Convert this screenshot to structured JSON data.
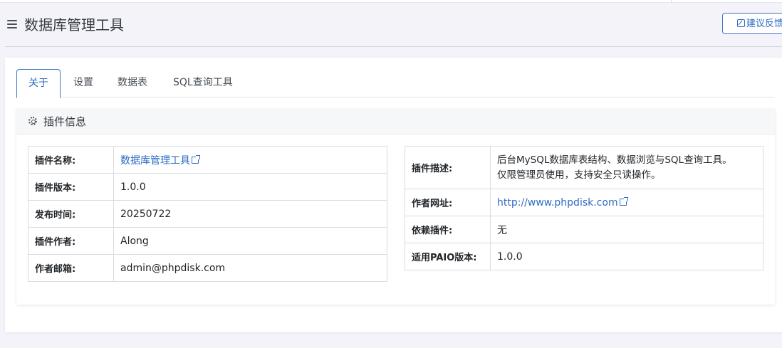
{
  "header": {
    "title": "数据库管理工具",
    "feedback_label": "建议反馈"
  },
  "tabs": [
    {
      "label": "关于",
      "active": true
    },
    {
      "label": "设置",
      "active": false
    },
    {
      "label": "数据表",
      "active": false
    },
    {
      "label": "SQL查询工具",
      "active": false
    }
  ],
  "plugin_info": {
    "title": "插件信息",
    "left": [
      {
        "key": "插件名称:",
        "value": "数据库管理工具",
        "link": true
      },
      {
        "key": "插件版本:",
        "value": "1.0.0"
      },
      {
        "key": "发布时间:",
        "value": "20250722"
      },
      {
        "key": "插件作者:",
        "value": "Along"
      },
      {
        "key": "作者邮箱:",
        "value": "admin@phpdisk.com"
      }
    ],
    "right": [
      {
        "key": "插件描述:",
        "value_line1": "后台MySQL数据库表结构、数据浏览与SQL查询工具。",
        "value_line2": "仅限管理员使用，支持安全只读操作。"
      },
      {
        "key": "作者网址:",
        "value": "http://www.phpdisk.com",
        "link": true
      },
      {
        "key": "依赖插件:",
        "value": "无"
      },
      {
        "key": "适用PAIO版本:",
        "value": "1.0.0"
      }
    ]
  },
  "colors": {
    "accent": "#2d6bc4",
    "background": "#f3f3f9"
  }
}
